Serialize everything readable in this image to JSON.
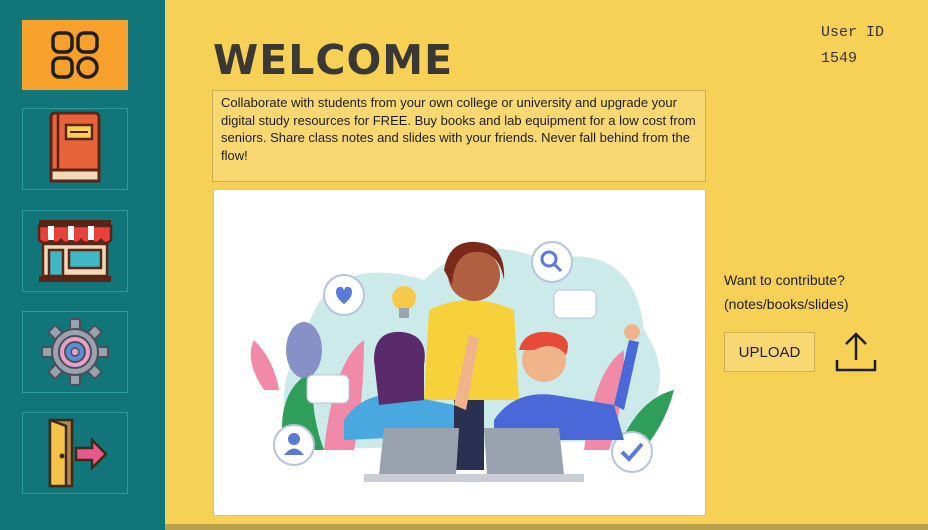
{
  "sidebar": {
    "items": [
      {
        "name": "dashboard",
        "icon": "grid-icon",
        "active": true
      },
      {
        "name": "books",
        "icon": "book-icon",
        "active": false
      },
      {
        "name": "store",
        "icon": "store-icon",
        "active": false
      },
      {
        "name": "settings",
        "icon": "gear-icon",
        "active": false
      },
      {
        "name": "logout",
        "icon": "exit-door-icon",
        "active": false
      }
    ]
  },
  "header": {
    "title": "WELCOME",
    "user_id_label": "User ID",
    "user_id_value": "1549"
  },
  "main": {
    "description": "Collaborate with students from your own college or university and upgrade your digital study resources for FREE. Buy books and lab equipment for a low cost from seniors. Share class notes and slides with your friends. Never fall behind from the flow!"
  },
  "contribute": {
    "line1": "Want to contribute?",
    "line2": "(notes/books/slides)",
    "upload_label": "UPLOAD"
  },
  "colors": {
    "background": "#f6d155",
    "sidebar": "#12757a",
    "active": "#f7a12c"
  }
}
